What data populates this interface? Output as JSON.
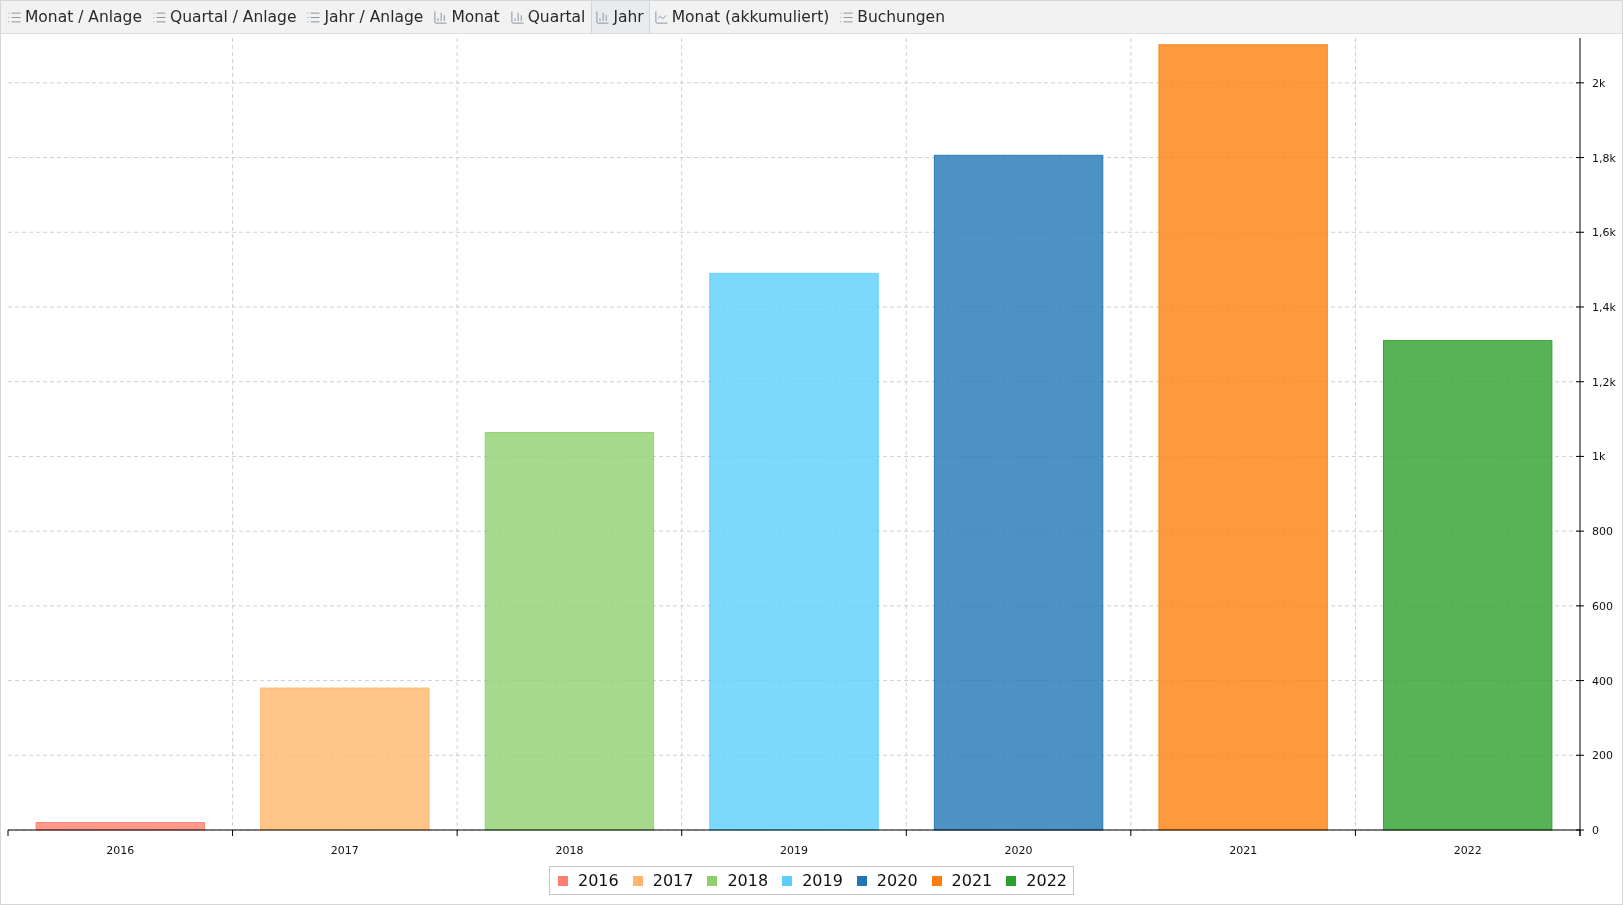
{
  "tabs": [
    {
      "label": "Monat / Anlage",
      "kind": "list",
      "selected": false
    },
    {
      "label": "Quartal / Anlage",
      "kind": "list",
      "selected": false
    },
    {
      "label": "Jahr / Anlage",
      "kind": "list",
      "selected": false
    },
    {
      "label": "Monat",
      "kind": "bar",
      "selected": false
    },
    {
      "label": "Quartal",
      "kind": "bar",
      "selected": false
    },
    {
      "label": "Jahr",
      "kind": "bar",
      "selected": true
    },
    {
      "label": "Monat (akkumuliert)",
      "kind": "line",
      "selected": false
    },
    {
      "label": "Buchungen",
      "kind": "list",
      "selected": false
    }
  ],
  "chart_data": {
    "type": "bar",
    "categories": [
      "2016",
      "2017",
      "2018",
      "2019",
      "2020",
      "2021",
      "2022"
    ],
    "series": [
      {
        "name": "2016",
        "color": "#ff7f6e",
        "values": [
          20,
          null,
          null,
          null,
          null,
          null,
          null
        ]
      },
      {
        "name": "2017",
        "color": "#ffb66b",
        "values": [
          null,
          380,
          null,
          null,
          null,
          null,
          null
        ]
      },
      {
        "name": "2018",
        "color": "#8fcf6e",
        "values": [
          null,
          null,
          1064,
          null,
          null,
          null,
          null
        ]
      },
      {
        "name": "2019",
        "color": "#5bcffb",
        "values": [
          null,
          null,
          null,
          1490,
          null,
          null,
          null
        ]
      },
      {
        "name": "2020",
        "color": "#1f77b4",
        "values": [
          null,
          null,
          null,
          null,
          1806,
          null,
          null
        ]
      },
      {
        "name": "2021",
        "color": "#ff7f0e",
        "values": [
          null,
          null,
          null,
          null,
          null,
          2102,
          null
        ]
      },
      {
        "name": "2022",
        "color": "#2ca02c",
        "values": [
          null,
          null,
          null,
          null,
          null,
          null,
          1310
        ]
      }
    ],
    "grid": true,
    "legend": "bottom",
    "ylim": [
      0,
      2120
    ],
    "yticks": [
      0,
      200,
      400,
      600,
      800,
      {
        "value": 1000,
        "label": "1k"
      },
      {
        "value": 1200,
        "label": "1,2k"
      },
      {
        "value": 1400,
        "label": "1,4k"
      },
      {
        "value": 1600,
        "label": "1,6k"
      },
      {
        "value": 1800,
        "label": "1,8k"
      },
      {
        "value": 2000,
        "label": "2k"
      }
    ]
  }
}
